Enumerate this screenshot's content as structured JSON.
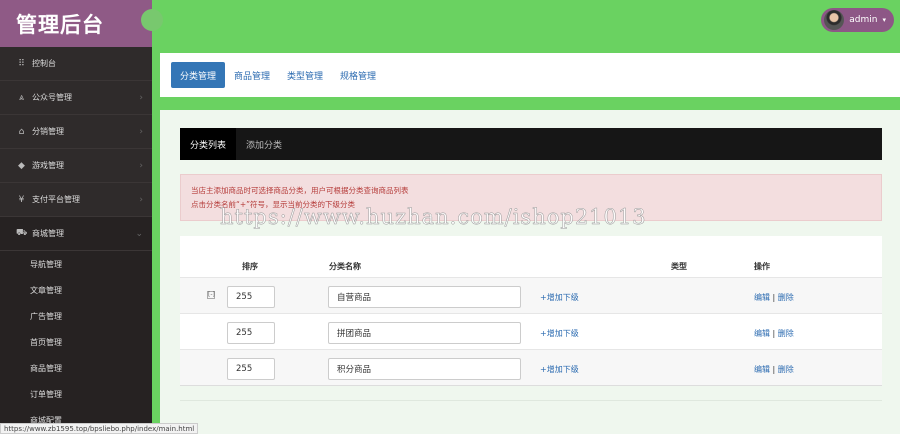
{
  "brand": {
    "title": "管理后台"
  },
  "user": {
    "name": "admin"
  },
  "sidebar": {
    "items": [
      {
        "label": "控制台",
        "icon": "grid-icon",
        "glyph": "⠿"
      },
      {
        "label": "公众号管理",
        "icon": "road-icon",
        "glyph": "⩓"
      },
      {
        "label": "分销管理",
        "icon": "home-icon",
        "glyph": "⌂"
      },
      {
        "label": "游戏管理",
        "icon": "tags-icon",
        "glyph": "◆"
      },
      {
        "label": "支付平台管理",
        "icon": "yen-icon",
        "glyph": "¥"
      },
      {
        "label": "商城管理",
        "icon": "cart-icon",
        "glyph": "⛟"
      }
    ],
    "subitems": [
      "导航管理",
      "文章管理",
      "广告管理",
      "首页管理",
      "商品管理",
      "订单管理",
      "商城配置"
    ]
  },
  "statusbar": {
    "url": "https://www.zb1595.top/bpsliebo.php/index/main.html"
  },
  "tabs": [
    "分类管理",
    "商品管理",
    "类型管理",
    "规格管理"
  ],
  "subtabs": [
    "分类列表",
    "添加分类"
  ],
  "alert": {
    "line1": "当店主添加商品时可选择商品分类，用户可根据分类查询商品列表",
    "line2": "点击分类名前“+”符号，显示当前分类的下级分类"
  },
  "watermark": "https://www.huzhan.com/ishop21013",
  "table": {
    "headers": {
      "sort": "排序",
      "name": "分类名称",
      "type": "类型",
      "ops": "操作"
    },
    "expand_glyph": "[-]",
    "add_child_label": "+增加下级",
    "edit_label": "编辑",
    "separator": "|",
    "delete_label": "删除",
    "rows": [
      {
        "sort": "255",
        "name": "自营商品"
      },
      {
        "sort": "255",
        "name": "拼团商品"
      },
      {
        "sort": "255",
        "name": "积分商品"
      }
    ]
  },
  "colors": {
    "topbar": "#6ad261",
    "brand": "#8f5a86",
    "sidebar": "#2f2b2b",
    "active_tab": "#3476b6",
    "alert_text": "#b53c3a"
  }
}
